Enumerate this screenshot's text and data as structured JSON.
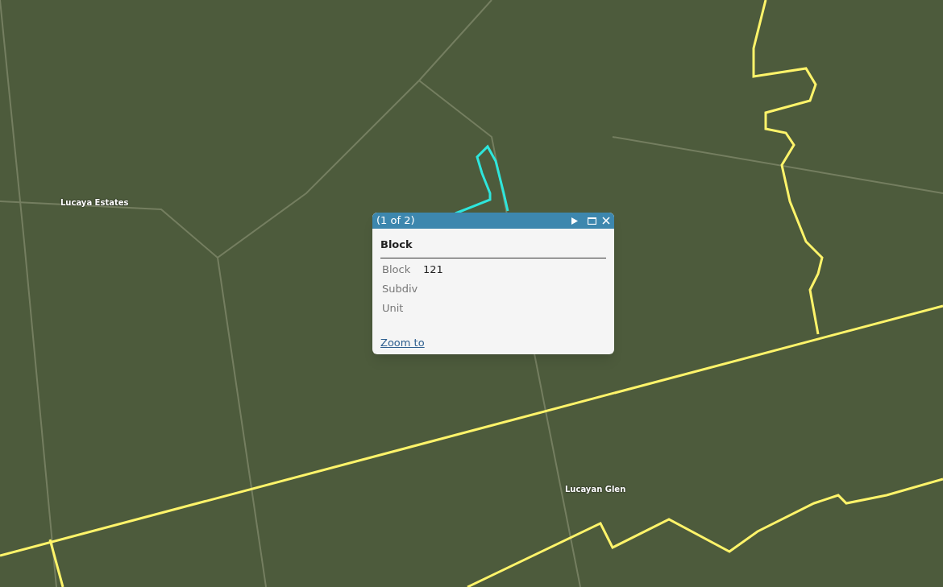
{
  "map": {
    "labels": [
      {
        "text": "Lucaya Estates"
      },
      {
        "text": "Lucayan Glen"
      }
    ]
  },
  "popup": {
    "pager": "(1 of 2)",
    "title": "Block",
    "fields": [
      {
        "label": "Block",
        "value": "121"
      },
      {
        "label": "Subdiv"
      },
      {
        "label": "Unit"
      }
    ],
    "link": "Zoom to"
  }
}
